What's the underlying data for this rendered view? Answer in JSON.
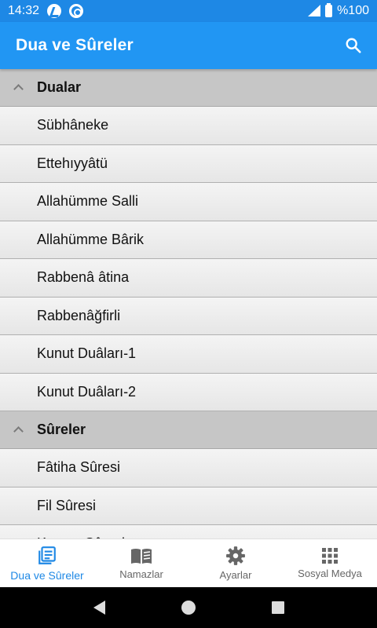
{
  "status": {
    "time": "14:32",
    "battery": "%100"
  },
  "app_bar": {
    "title": "Dua ve Sûreler"
  },
  "groups": [
    {
      "title": "Dualar",
      "items": [
        "Sübhâneke",
        "Ettehıyyâtü",
        "Allahümme Salli",
        "Allahümme Bârik",
        "Rabbenâ âtina",
        "Rabbenâğfirli",
        "Kunut Duâları-1",
        "Kunut Duâları-2"
      ]
    },
    {
      "title": "Sûreler",
      "items": [
        "Fâtiha Sûresi",
        "Fil Sûresi",
        "Kureyş Sûresi"
      ]
    }
  ],
  "bottom_nav": [
    {
      "label": "Dua ve Sûreler",
      "icon": "book-list-icon",
      "active": true
    },
    {
      "label": "Namazlar",
      "icon": "open-book-icon",
      "active": false
    },
    {
      "label": "Ayarlar",
      "icon": "gear-icon",
      "active": false
    },
    {
      "label": "Sosyal Medya",
      "icon": "grid-icon",
      "active": false
    }
  ],
  "colors": {
    "status_bar": "#1e88e5",
    "app_bar": "#2196f3",
    "accent": "#1e88e5",
    "group_header": "#c6c6c6"
  }
}
